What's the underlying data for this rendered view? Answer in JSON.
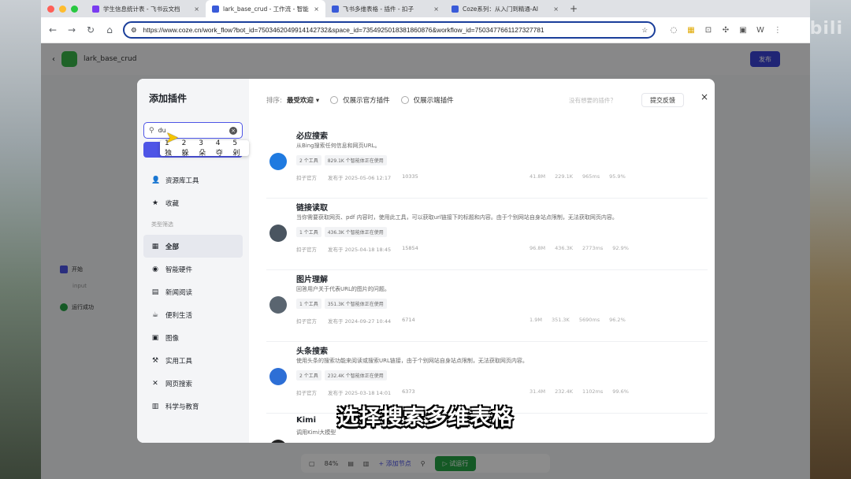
{
  "browser": {
    "tabs": [
      {
        "title": "学生信息统计表 - 飞书云文档",
        "color": "#7a3cf0",
        "active": false
      },
      {
        "title": "lark_base_crud - 工作流 - 智能",
        "color": "#3a5bd9",
        "active": true
      },
      {
        "title": "飞书多维表格 - 插件 - 扣子",
        "color": "#3a5bd9",
        "active": false
      },
      {
        "title": "Coze系列：从入门到精通-AI",
        "color": "#3a5bd9",
        "active": false
      }
    ],
    "new_tab": "+",
    "url": "https://www.coze.cn/work_flow?bot_id=7503462049914142732&space_id=7354925018381860876&workflow_id=7503477661127327781",
    "watermark": "bilibili"
  },
  "app": {
    "workflow_name": "lark_base_crud",
    "publish_label": "发布",
    "node_start": "开始",
    "node_input": "input",
    "node_success": "运行成功",
    "zoom": "84%",
    "add_node_label": "+ 添加节点",
    "test_run_label": "▷ 试运行"
  },
  "modal": {
    "title": "添加插件",
    "search_value": "du",
    "ime_candidates": [
      "1 独",
      "2 躲",
      "3 朵",
      "4 夺",
      "5 剁"
    ],
    "create_label": "创建插件",
    "side_top": [
      {
        "label": "资源库工具",
        "icon": "user-icon"
      },
      {
        "label": "收藏",
        "icon": "star-icon"
      }
    ],
    "category_group": "类型筛选",
    "categories": [
      {
        "label": "全部",
        "icon": "grid-icon",
        "active": true
      },
      {
        "label": "智能硬件",
        "icon": "device-icon"
      },
      {
        "label": "新闻阅读",
        "icon": "news-icon"
      },
      {
        "label": "便利生活",
        "icon": "cup-icon"
      },
      {
        "label": "图像",
        "icon": "image-icon"
      },
      {
        "label": "实用工具",
        "icon": "tool-icon"
      },
      {
        "label": "网页搜索",
        "icon": "cross-icon"
      },
      {
        "label": "科学与教育",
        "icon": "book-icon"
      }
    ],
    "sort_label": "排序:",
    "sort_value": "最受欢迎",
    "filter_official": "仅展示官方插件",
    "filter_device": "仅展示端插件",
    "search_hint": "没有想要的插件？",
    "feedback_label": "提交反馈",
    "close": "×",
    "plugins": [
      {
        "name": "必应搜索",
        "desc": "从Bing搜索任何信息和网页URL。",
        "tags": [
          "2 个工具",
          "829.1K 个智能体正在使用"
        ],
        "author": "扣子官方",
        "date": "发布于 2025-05-06 12:17",
        "favs": "10335",
        "stats": [
          "41.8M",
          "229.1K",
          "965ms",
          "95.9%"
        ],
        "logo": "#1f7ae0"
      },
      {
        "name": "链接读取",
        "desc": "当你需要获取网页、pdf 内容时，使用此工具，可以获取url链接下的标题和内容。由于个别网站自身站点限制，无法获取网页内容。",
        "tags": [
          "1 个工具",
          "436.3K 个智能体正在使用"
        ],
        "author": "扣子官方",
        "date": "发布于 2025-04-18 18:45",
        "favs": "15854",
        "stats": [
          "96.8M",
          "436.3K",
          "2773ms",
          "92.9%"
        ],
        "logo": "#4a5560"
      },
      {
        "name": "图片理解",
        "desc": "回答用户关于代表URL的图片的问题。",
        "tags": [
          "1 个工具",
          "351.3K 个智能体正在使用"
        ],
        "author": "扣子官方",
        "date": "发布于 2024-09-27 10:44",
        "favs": "6714",
        "stats": [
          "1.9M",
          "351.3K",
          "5690ms",
          "96.2%"
        ],
        "logo": "#5a6570"
      },
      {
        "name": "头条搜索",
        "desc": "使用头条的搜索功能来阅读或搜索URL链接，由于个别网站自身站点限制，无法获取网页内容。",
        "tags": [
          "2 个工具",
          "232.4K 个智能体正在使用"
        ],
        "author": "扣子官方",
        "date": "发布于 2025-03-18 14:01",
        "favs": "6373",
        "stats": [
          "31.4M",
          "232.4K",
          "1102ms",
          "99.6%"
        ],
        "logo": "#2d6fd6"
      },
      {
        "name": "Kimi",
        "desc": "调用Kimi大模型",
        "tags": [],
        "author": "",
        "date": "",
        "favs": "",
        "stats": [],
        "logo": "#222222"
      }
    ]
  },
  "subtitle": "选择搜索多维表格"
}
